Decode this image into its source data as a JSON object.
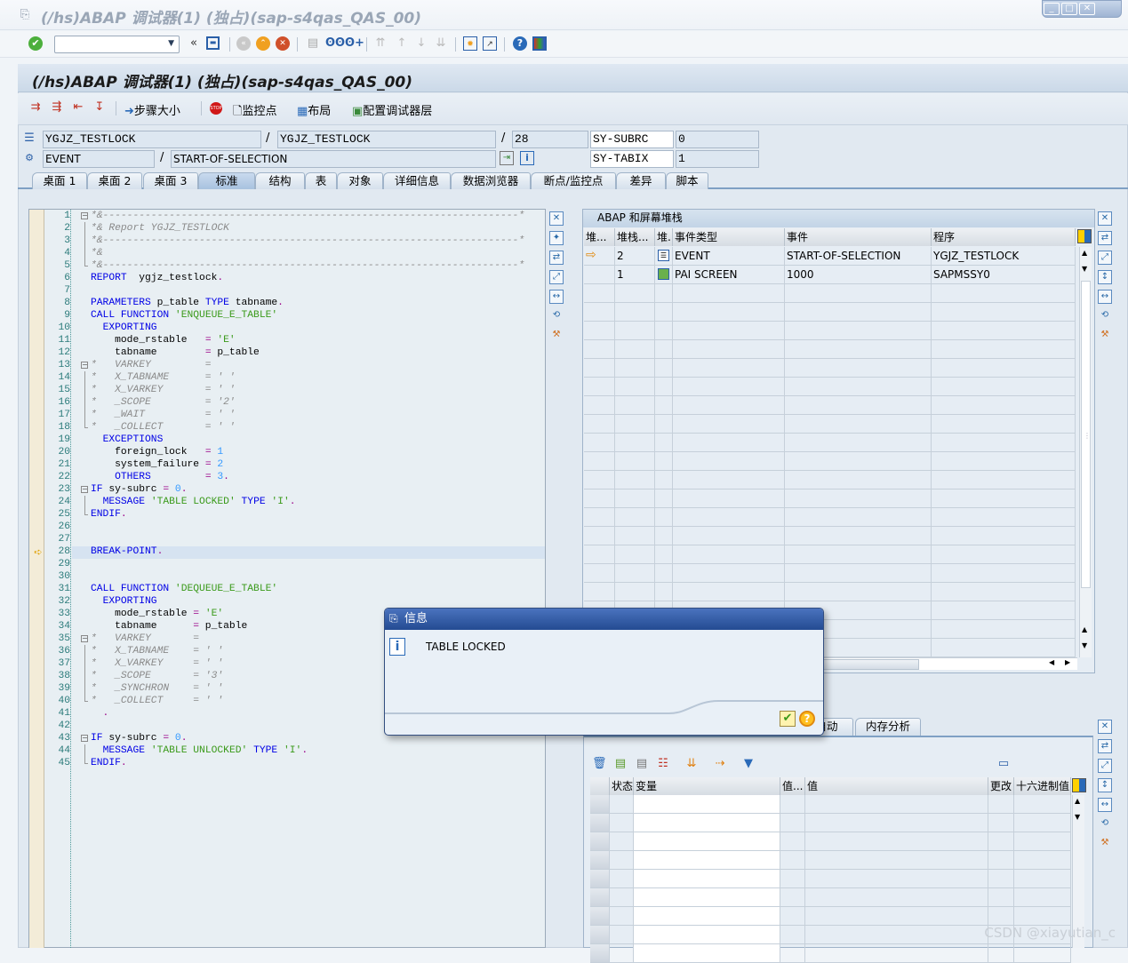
{
  "window": {
    "title": "(/hs)ABAP 调试器(1) (独占)(sap-s4qas_QAS_00)",
    "controls": [
      "_",
      "□",
      "✕"
    ]
  },
  "system_toolbar": {
    "command_field": "",
    "icons": [
      "enter-check-icon",
      "save-icon",
      "back-icon",
      "exit-icon",
      "cancel-icon",
      "print-icon",
      "find-icon",
      "find-next-icon",
      "first-page-icon",
      "prev-page-icon",
      "next-page-icon",
      "last-page-icon",
      "new-session-icon",
      "shortcut-icon",
      "help-icon",
      "customize-layout-icon"
    ]
  },
  "header": {
    "title": "(/hs)ABAP 调试器(1) (独占)(sap-s4qas_QAS_00)"
  },
  "app_toolbar": {
    "step_size": "步骤大小",
    "watchpoint": "监控点",
    "layout": "布局",
    "config_layer": "配置调试器层"
  },
  "fields": {
    "program": "YGJZ_TESTLOCK",
    "include": "YGJZ_TESTLOCK",
    "line": "28",
    "sysubrc_label": "SY-SUBRC",
    "sysubrc": "0",
    "event_type": "EVENT",
    "event": "START-OF-SELECTION",
    "sytabix_label": "SY-TABIX",
    "sytabix": "1"
  },
  "tabs": [
    "桌面 1",
    "桌面 2",
    "桌面 3",
    "标准",
    "结构",
    "表",
    "对象",
    "详细信息",
    "数据浏览器",
    "断点/监控点",
    "差异",
    "脚本"
  ],
  "active_tab": "标准",
  "code": {
    "current_line": 28,
    "lines": [
      [
        [
          "cmt",
          "*&---------------------------------------------------------------------*"
        ]
      ],
      [
        [
          "cmt",
          "*& Report YGJZ_TESTLOCK"
        ]
      ],
      [
        [
          "cmt",
          "*&---------------------------------------------------------------------*"
        ]
      ],
      [
        [
          "cmt",
          "*&"
        ]
      ],
      [
        [
          "cmt",
          "*&---------------------------------------------------------------------*"
        ]
      ],
      [
        [
          "kw",
          "REPORT"
        ],
        [
          "",
          "  ygjz_testlock"
        ],
        [
          "op",
          "."
        ]
      ],
      [],
      [
        [
          "kw",
          "PARAMETERS"
        ],
        [
          "",
          " p_table "
        ],
        [
          "kw",
          "TYPE"
        ],
        [
          "",
          " tabname"
        ],
        [
          "op",
          "."
        ]
      ],
      [
        [
          "kw",
          "CALL FUNCTION"
        ],
        [
          "",
          " "
        ],
        [
          "str",
          "'ENQUEUE_E_TABLE'"
        ]
      ],
      [
        [
          "",
          "  "
        ],
        [
          "kw",
          "EXPORTING"
        ]
      ],
      [
        [
          "",
          "    mode_rstable   "
        ],
        [
          "op",
          "="
        ],
        [
          "",
          " "
        ],
        [
          "str",
          "'E'"
        ]
      ],
      [
        [
          "",
          "    tabname        "
        ],
        [
          "op",
          "="
        ],
        [
          "",
          " p_table"
        ]
      ],
      [
        [
          "cmt",
          "*   VARKEY         ="
        ]
      ],
      [
        [
          "cmt",
          "*   X_TABNAME      = ' '"
        ]
      ],
      [
        [
          "cmt",
          "*   X_VARKEY       = ' '"
        ]
      ],
      [
        [
          "cmt",
          "*   _SCOPE         = '2'"
        ]
      ],
      [
        [
          "cmt",
          "*   _WAIT          = ' '"
        ]
      ],
      [
        [
          "cmt",
          "*   _COLLECT       = ' '"
        ]
      ],
      [
        [
          "",
          "  "
        ],
        [
          "kw",
          "EXCEPTIONS"
        ]
      ],
      [
        [
          "",
          "    foreign_lock   "
        ],
        [
          "op",
          "="
        ],
        [
          "",
          " "
        ],
        [
          "num",
          "1"
        ]
      ],
      [
        [
          "",
          "    system_failure "
        ],
        [
          "op",
          "="
        ],
        [
          "",
          " "
        ],
        [
          "num",
          "2"
        ]
      ],
      [
        [
          "",
          "    "
        ],
        [
          "kw",
          "OTHERS"
        ],
        [
          "",
          "         "
        ],
        [
          "op",
          "="
        ],
        [
          "",
          " "
        ],
        [
          "num",
          "3"
        ],
        [
          "op",
          "."
        ]
      ],
      [
        [
          "kw",
          "IF"
        ],
        [
          "",
          " sy-subrc "
        ],
        [
          "op",
          "="
        ],
        [
          "",
          " "
        ],
        [
          "num",
          "0"
        ],
        [
          "op",
          "."
        ]
      ],
      [
        [
          "",
          "  "
        ],
        [
          "kw",
          "MESSAGE"
        ],
        [
          "",
          " "
        ],
        [
          "str",
          "'TABLE LOCKED'"
        ],
        [
          "",
          " "
        ],
        [
          "kw",
          "TYPE"
        ],
        [
          "",
          " "
        ],
        [
          "str",
          "'I'"
        ],
        [
          "op",
          "."
        ]
      ],
      [
        [
          "kw",
          "ENDIF"
        ],
        [
          "op",
          "."
        ]
      ],
      [],
      [],
      [
        [
          "kw",
          "BREAK-POINT"
        ],
        [
          "op",
          "."
        ]
      ],
      [],
      [],
      [
        [
          "kw",
          "CALL FUNCTION"
        ],
        [
          "",
          " "
        ],
        [
          "str",
          "'DEQUEUE_E_TABLE'"
        ]
      ],
      [
        [
          "",
          "  "
        ],
        [
          "kw",
          "EXPORTING"
        ]
      ],
      [
        [
          "",
          "    mode_rstable "
        ],
        [
          "op",
          "="
        ],
        [
          "",
          " "
        ],
        [
          "str",
          "'E'"
        ]
      ],
      [
        [
          "",
          "    tabname      "
        ],
        [
          "op",
          "="
        ],
        [
          "",
          " p_table"
        ]
      ],
      [
        [
          "cmt",
          "*   VARKEY       ="
        ]
      ],
      [
        [
          "cmt",
          "*   X_TABNAME    = ' '"
        ]
      ],
      [
        [
          "cmt",
          "*   X_VARKEY     = ' '"
        ]
      ],
      [
        [
          "cmt",
          "*   _SCOPE       = '3'"
        ]
      ],
      [
        [
          "cmt",
          "*   _SYNCHRON    = ' '"
        ]
      ],
      [
        [
          "cmt",
          "*   _COLLECT     = ' '"
        ]
      ],
      [
        [
          "op",
          "  ."
        ]
      ],
      [],
      [
        [
          "kw",
          "IF"
        ],
        [
          "",
          " sy-subrc "
        ],
        [
          "op",
          "="
        ],
        [
          "",
          " "
        ],
        [
          "num",
          "0"
        ],
        [
          "op",
          "."
        ]
      ],
      [
        [
          "",
          "  "
        ],
        [
          "kw",
          "MESSAGE"
        ],
        [
          "",
          " "
        ],
        [
          "str",
          "'TABLE UNLOCKED'"
        ],
        [
          "",
          " "
        ],
        [
          "kw",
          "TYPE"
        ],
        [
          "",
          " "
        ],
        [
          "str",
          "'I'"
        ],
        [
          "op",
          "."
        ]
      ],
      [
        [
          "kw",
          "ENDIF"
        ],
        [
          "op",
          "."
        ]
      ]
    ]
  },
  "stack": {
    "title": "ABAP 和屏幕堆栈",
    "columns": [
      "堆...",
      "堆栈...",
      "堆.",
      "事件类型",
      "事件",
      "程序"
    ],
    "rows": [
      {
        "current": true,
        "level": "2",
        "icon": "event-icon",
        "type": "EVENT",
        "event": "START-OF-SELECTION",
        "program": "YGJZ_TESTLOCK"
      },
      {
        "current": false,
        "level": "1",
        "icon": "screen-icon",
        "type": "PAI SCREEN",
        "event": "1000",
        "program": "SAPMSSY0"
      }
    ]
  },
  "variables": {
    "tabs": [
      "自动",
      "内存分析"
    ],
    "columns": [
      "状态",
      "变量",
      "值...",
      "值",
      "更改",
      "十六进制值"
    ]
  },
  "dialog": {
    "title": "信息",
    "message": "TABLE LOCKED"
  },
  "watermark": "CSDN @xiayutian_c",
  "colors": {
    "keyword": "#0000e6",
    "string": "#3a9a1a",
    "comment": "#8a8a8a",
    "number": "#3399ff",
    "dialog_title": "#2f579f"
  }
}
